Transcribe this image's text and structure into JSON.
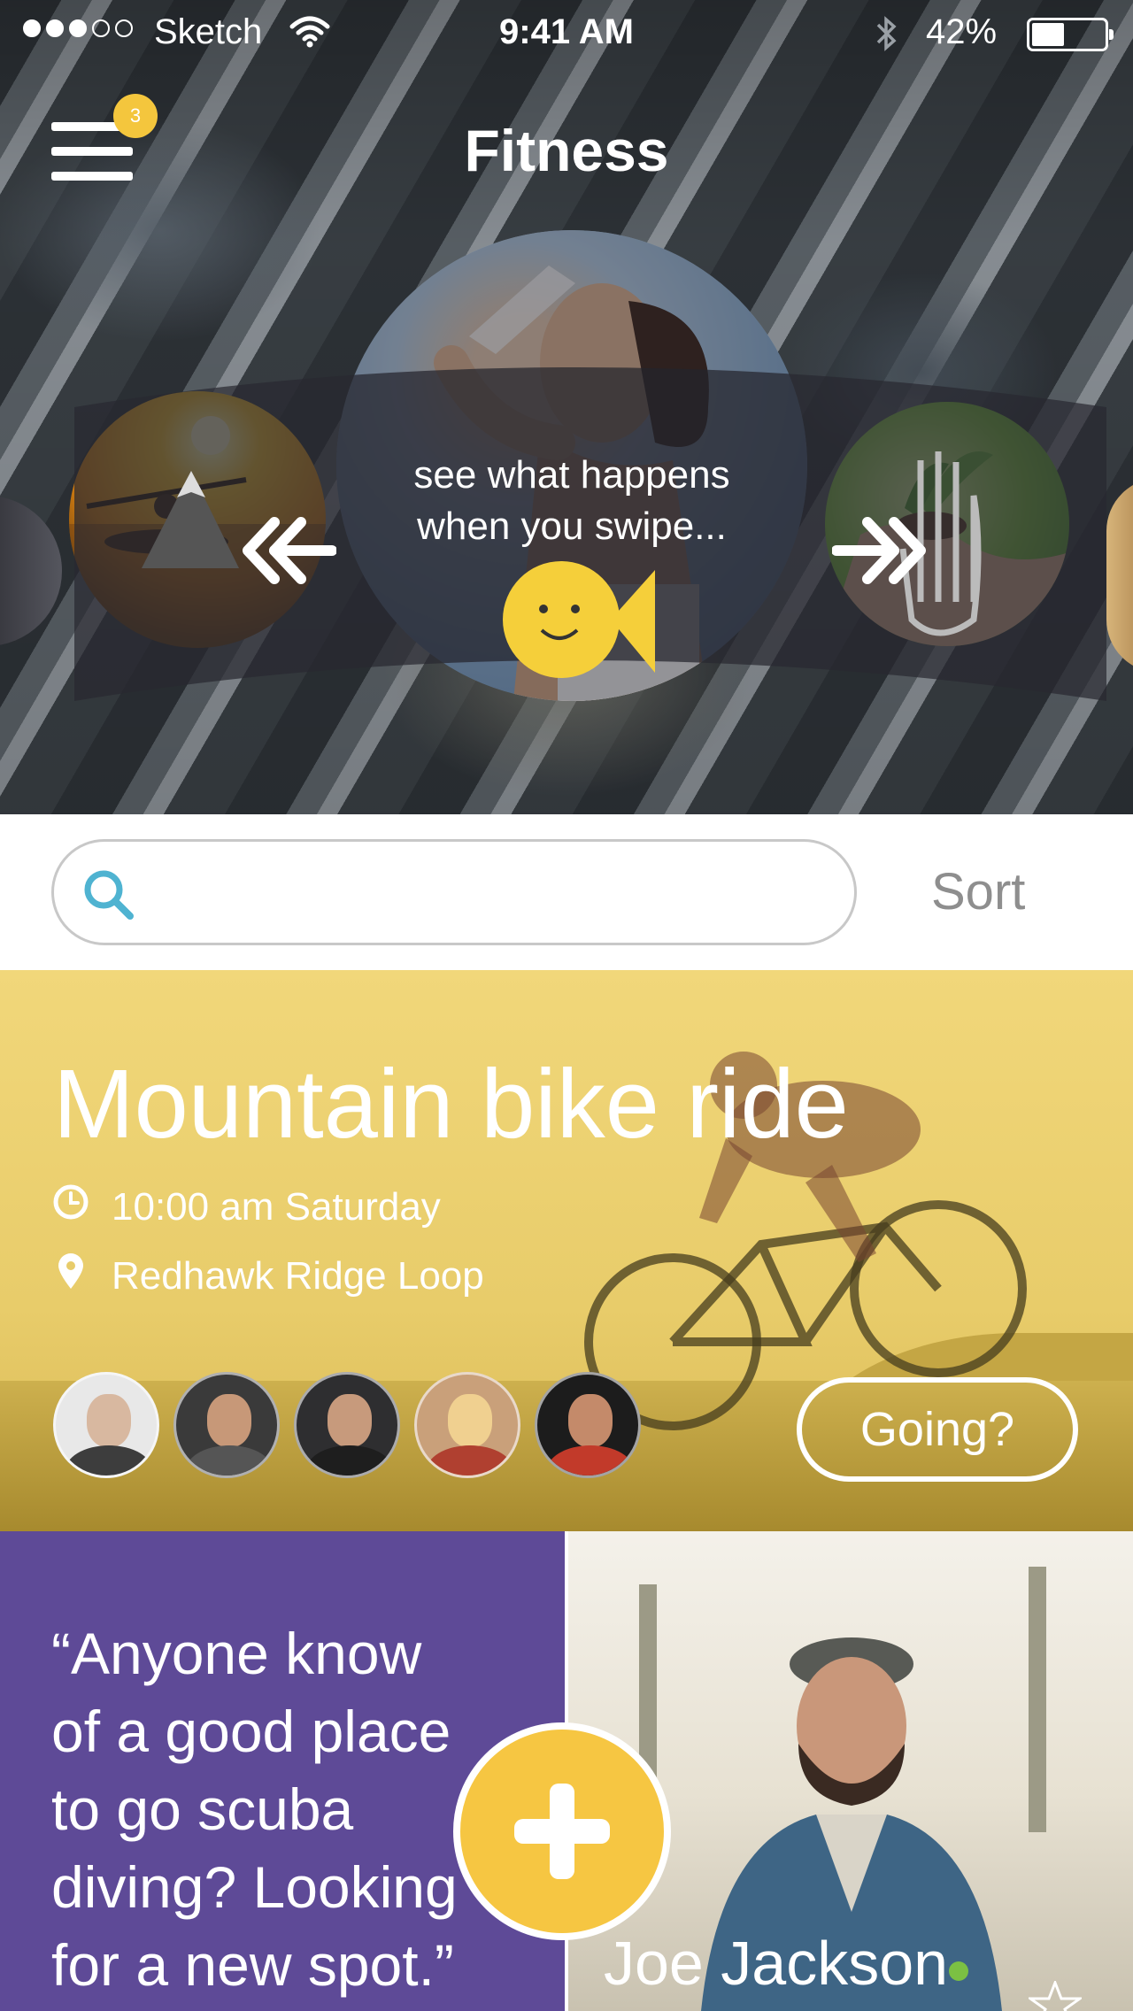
{
  "status_bar": {
    "carrier": "Sketch",
    "time": "9:41 AM",
    "battery_percent": "42%",
    "battery_level": 0.42,
    "signal_bars_filled": 3,
    "signal_bars_total": 5
  },
  "header": {
    "title": "Fitness",
    "notification_count": "3",
    "menu_icon": "hamburger-menu-icon"
  },
  "carousel": {
    "hint": "see what happens when you swipe...",
    "hint_line1": "see what happens",
    "hint_line2": "when you swipe...",
    "items": [
      {
        "name": "kayak-sunset",
        "icon": "mountain-icon"
      },
      {
        "name": "woman-drinking-water",
        "icon": "fish-smiley-icon"
      },
      {
        "name": "plant-in-hands",
        "icon": "hand-icon"
      }
    ]
  },
  "search": {
    "placeholder": "",
    "value": "",
    "sort_label": "Sort"
  },
  "event": {
    "title": "Mountain bike ride",
    "time": "10:00 am Saturday",
    "location": "Redhawk Ridge Loop",
    "attendees_count": 5,
    "going_label": "Going?"
  },
  "quote_card": {
    "text_line1": "“Anyone know",
    "text_line2": "of a good place",
    "text_line3": "to go scuba",
    "text_line4": "diving? Looking",
    "text_line5": "for a new spot.”"
  },
  "profile_card": {
    "name": "Joe Jackson",
    "status": "online"
  },
  "colors": {
    "accent_yellow": "#f6c642",
    "quote_purple": "#5e4a97",
    "event_yellow": "#e8cc6a",
    "online_green": "#7bc043",
    "search_icon_blue": "#4fb3d1"
  }
}
